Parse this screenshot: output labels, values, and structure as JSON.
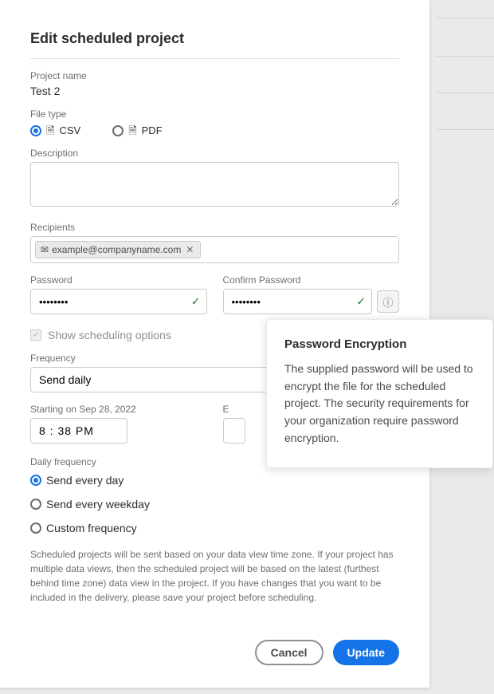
{
  "dialog": {
    "title": "Edit scheduled project",
    "project_name_label": "Project name",
    "project_name_value": "Test 2",
    "file_type_label": "File type",
    "file_type_csv": "CSV",
    "file_type_pdf": "PDF",
    "description_label": "Description",
    "description_value": "",
    "recipients_label": "Recipients",
    "recipients": [
      "example@companyname.com"
    ],
    "password_label": "Password",
    "password_value": "••••••••",
    "confirm_password_label": "Confirm Password",
    "confirm_password_value": "••••••••",
    "show_scheduling_label": "Show scheduling options",
    "frequency_label": "Frequency",
    "frequency_value": "Send daily",
    "starting_label": "Starting on Sep 28, 2022",
    "starting_time": "8 : 38   PM",
    "ending_label_prefix": "E",
    "daily_frequency_label": "Daily frequency",
    "daily_opts": {
      "every_day": "Send every day",
      "every_weekday": "Send every weekday",
      "custom": "Custom frequency"
    },
    "helper": "Scheduled projects will be sent based on your data view time zone. If your project has multiple data views, then the scheduled project will be based on the latest (furthest behind time zone) data view in the project. If you have changes that you want to be included in the delivery, please save your project before scheduling.",
    "cancel": "Cancel",
    "update": "Update"
  },
  "tooltip": {
    "title": "Password Encryption",
    "body": "The supplied password will be used to encrypt the file for the scheduled project. The security requirements for your organization require password encryption."
  }
}
